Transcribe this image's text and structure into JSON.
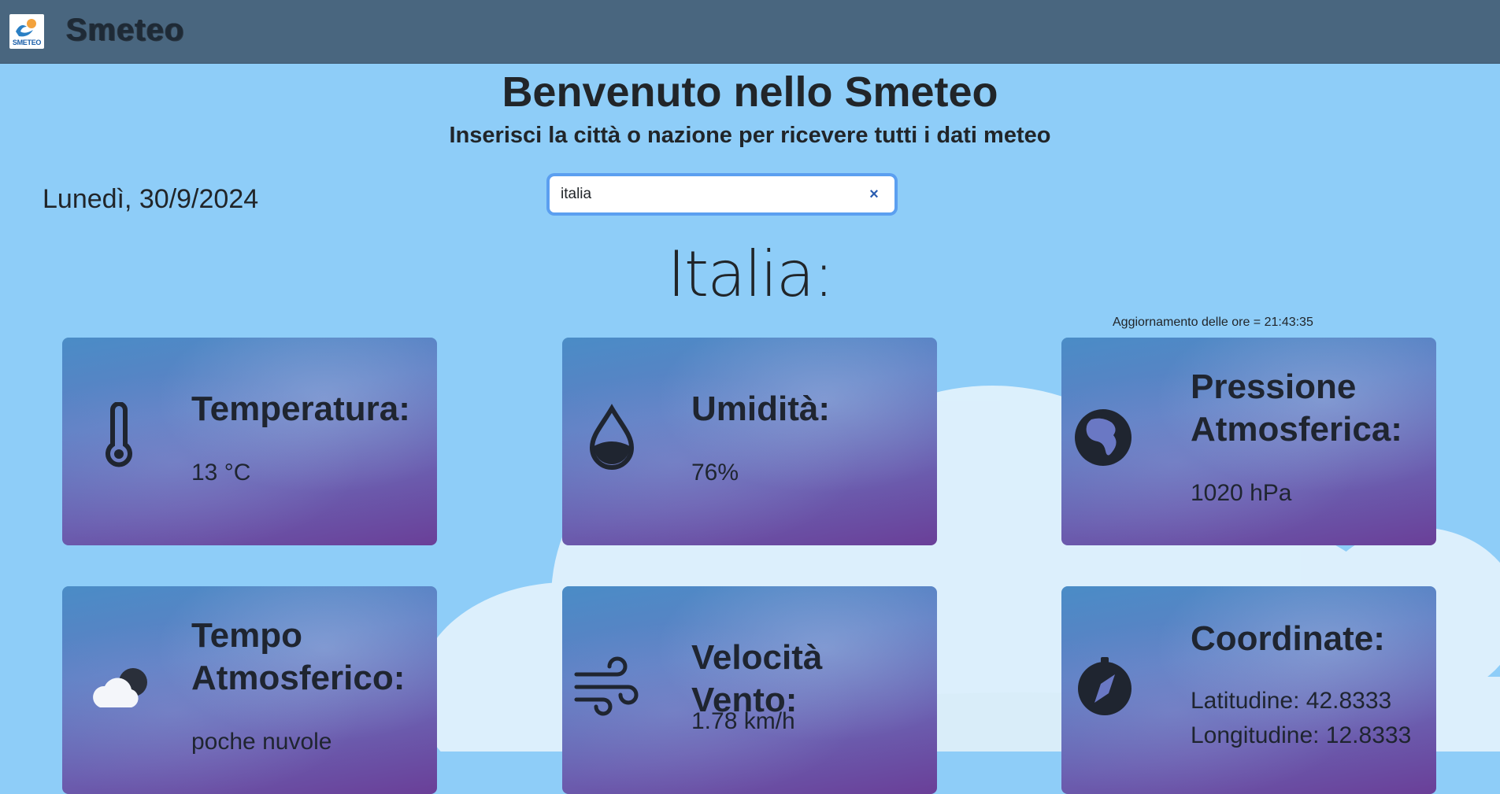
{
  "app": {
    "brand": "Smeteo",
    "logo_text": "SMETEO"
  },
  "header": {
    "title": "Benvenuto nello Smeteo",
    "subtitle": "Inserisci la città o nazione per ricevere tutti i dati meteo"
  },
  "date": "Lunedì, 30/9/2024",
  "search": {
    "value": "italia",
    "clear_label": "×"
  },
  "location": {
    "name": "Italia:",
    "update": "Aggiornamento delle ore = 21:43:35"
  },
  "cards": {
    "temperature": {
      "title": "Temperatura:",
      "value": "13 °C"
    },
    "humidity": {
      "title": "Umidità:",
      "value": "76%"
    },
    "pressure": {
      "title_line1": "Pressione",
      "title_line2": "Atmosferica:",
      "value": "1020 hPa"
    },
    "weather": {
      "title_line1": "Tempo",
      "title_line2": "Atmosferico:",
      "value": "poche nuvole"
    },
    "wind": {
      "title": "Velocità Vento:",
      "value": "1.78 km/h"
    },
    "coords": {
      "title": "Coordinate:",
      "latitude": "Latitudine: 42.8333",
      "longitude": "Longitudine: 12.8333"
    }
  },
  "icons": {
    "temperature": "thermometer-icon",
    "humidity": "droplet-icon",
    "pressure": "globe-africa-icon",
    "weather": "cloud-moon-icon",
    "wind": "wind-icon",
    "coords": "compass-icon",
    "search_clear": "close-icon"
  },
  "colors": {
    "navbar": "#49667f",
    "background": "#8ecdf8",
    "search_focus": "#5b9ff0",
    "card_top": "#4a8cc6",
    "card_bottom": "#6a3f98"
  }
}
